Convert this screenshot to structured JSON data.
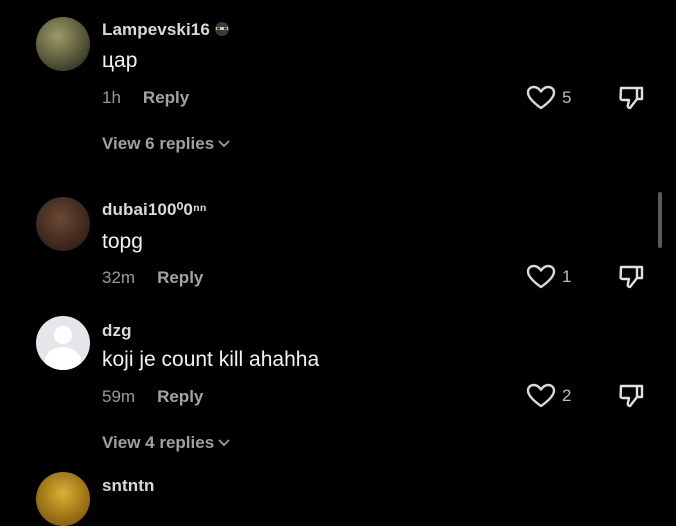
{
  "comments": [
    {
      "username": "Lampevski16",
      "text": "цар",
      "time": "1h",
      "reply": "Reply",
      "likes": "5",
      "view_replies": "View 6 replies"
    },
    {
      "username": "dubai100⁰0ⁿⁿ",
      "text": "topg",
      "time": "32m",
      "reply": "Reply",
      "likes": "1"
    },
    {
      "username": "dzg",
      "text": "koji je count kill ahahha",
      "time": "59m",
      "reply": "Reply",
      "likes": "2",
      "view_replies": "View 4 replies"
    },
    {
      "username": "sntntn"
    }
  ],
  "icons": {
    "like": "heart-outline-icon",
    "dislike": "thumbs-down-icon",
    "expand": "chevron-down-icon",
    "badge": "ninja-emoji-icon"
  },
  "colors": {
    "background": "#000000",
    "username": "#d9d9d9",
    "meta": "#9a9a9a"
  }
}
